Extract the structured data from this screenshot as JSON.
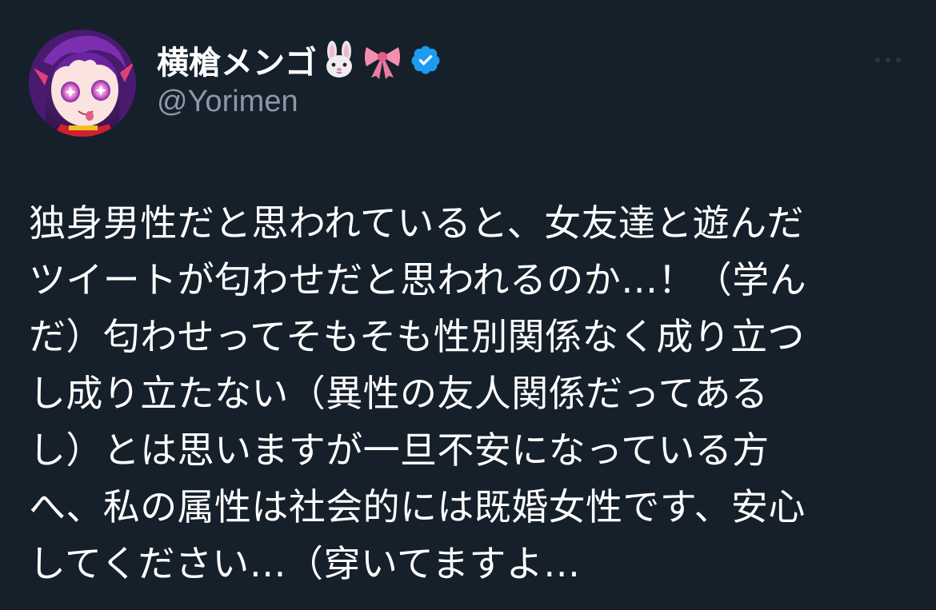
{
  "author": {
    "display_name": "横槍メンゴ",
    "handle": "@Yorimen",
    "name_emojis": [
      "rabbit-face",
      "ribbon"
    ],
    "verified": true,
    "avatar": "anime-avatar"
  },
  "tweet": {
    "lines": [
      "独身男性だと思われていると、女友達と遊んだ",
      "ツイートが匂わせだと思われるのか…！（学ん",
      "だ）匂わせってそもそも性別関係なく成り立つ",
      "し成り立たない（異性の友人関係だってある",
      "し）とは思いますが一旦不安になっている方",
      "へ、私の属性は社会的には既婚女性です、安心",
      "してください…（穿いてますよ…"
    ]
  },
  "colors": {
    "background": "#15202b",
    "text": "#ffffff",
    "secondary_text": "#8b98a5",
    "verified_blue": "#1d9bf0"
  }
}
